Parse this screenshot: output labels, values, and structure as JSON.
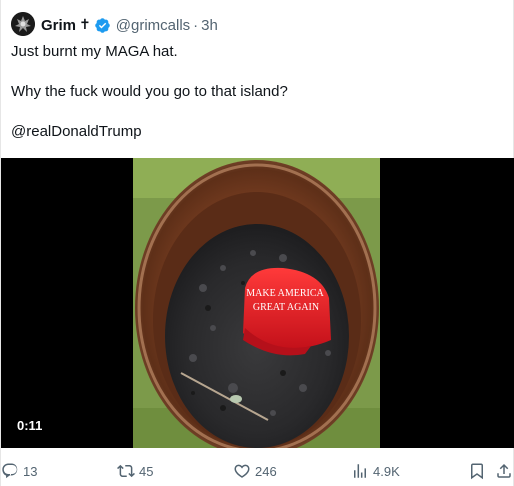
{
  "tweet": {
    "author_name": "Grim",
    "name_suffix": "✝",
    "handle": "@grimcalls",
    "separator": "·",
    "time": "3h",
    "lines": [
      "Just burnt my MAGA hat.",
      "Why the fuck would you go to that island?",
      "@realDonaldTrump"
    ],
    "verified_color": "#1d9bf0"
  },
  "media": {
    "duration": "0:11",
    "hat_text_line1": "MAKE AMERICA",
    "hat_text_line2": "GREAT AGAIN"
  },
  "actions": {
    "replies": "13",
    "reposts": "45",
    "likes": "246",
    "views": "4.9K",
    "icons": [
      "reply-icon",
      "repost-icon",
      "like-icon",
      "views-icon",
      "bookmark-icon",
      "share-icon"
    ]
  }
}
